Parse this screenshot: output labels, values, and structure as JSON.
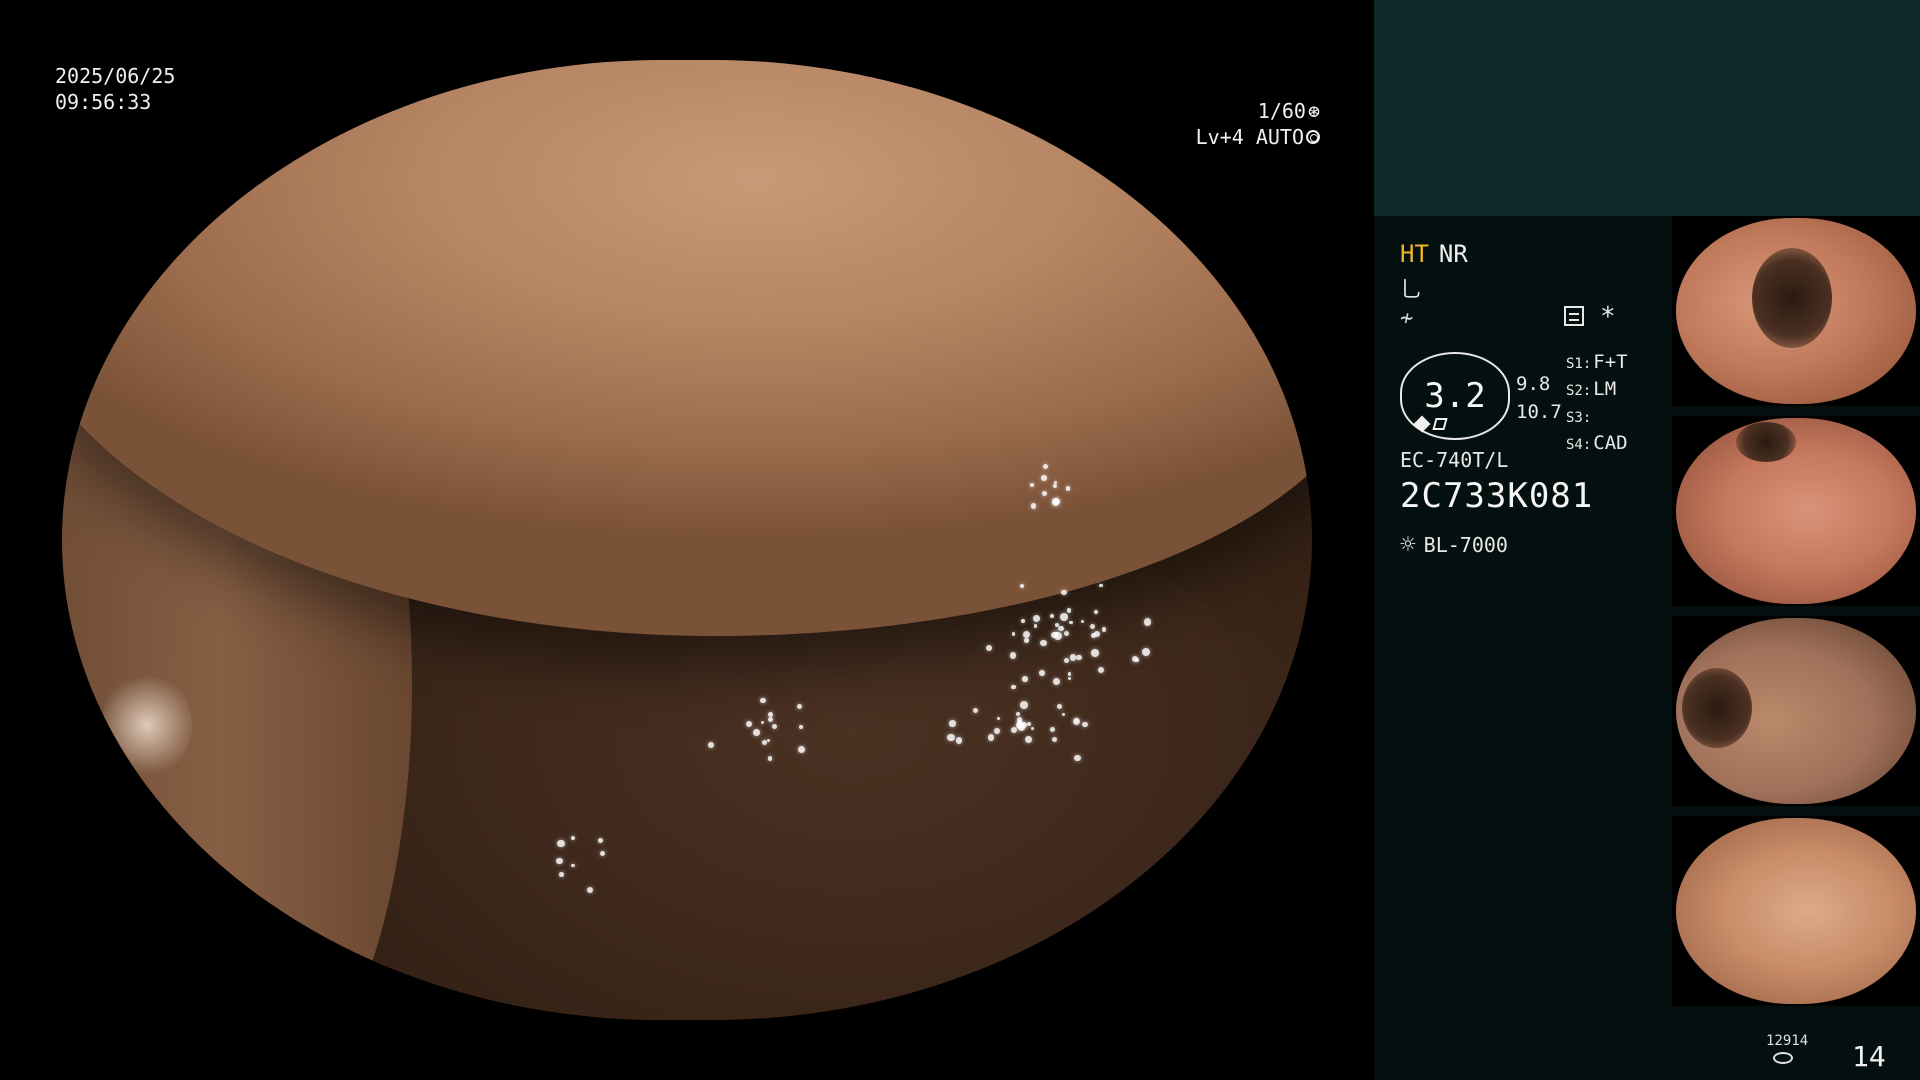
{
  "overlay": {
    "date": "2025/06/25",
    "time": "09:56:33",
    "shutter": "1/60",
    "iris": "Lv+4 AUTO"
  },
  "panel": {
    "mode_ht": "HT",
    "mode_nr": "NR",
    "enhance_value": "3.2",
    "side_top": "9.8",
    "side_bottom": "10.7",
    "asterisk": "*",
    "s_items": [
      {
        "label": "S1:",
        "value": "F+T"
      },
      {
        "label": "S2:",
        "value": "LM"
      },
      {
        "label": "S3:",
        "value": ""
      },
      {
        "label": "S4:",
        "value": "CAD"
      }
    ],
    "scope_model": "EC-740T/L",
    "scope_serial": "2C733K081",
    "light_source": "BL-7000",
    "image_count": "12914",
    "frame_number": "14"
  },
  "colors": {
    "accent_ht": "#f0b429",
    "panel_top": "#0d2a29",
    "panel_bg": "#04100f"
  },
  "icons": {
    "shutter": "aperture-icon",
    "iris": "iris-ring-icon",
    "structure": "structure-enhance-icon",
    "color": "color-enhance-icon",
    "settings": "settings-panel-icon",
    "light": "light-source-icon",
    "storage": "storage-disk-icon"
  }
}
